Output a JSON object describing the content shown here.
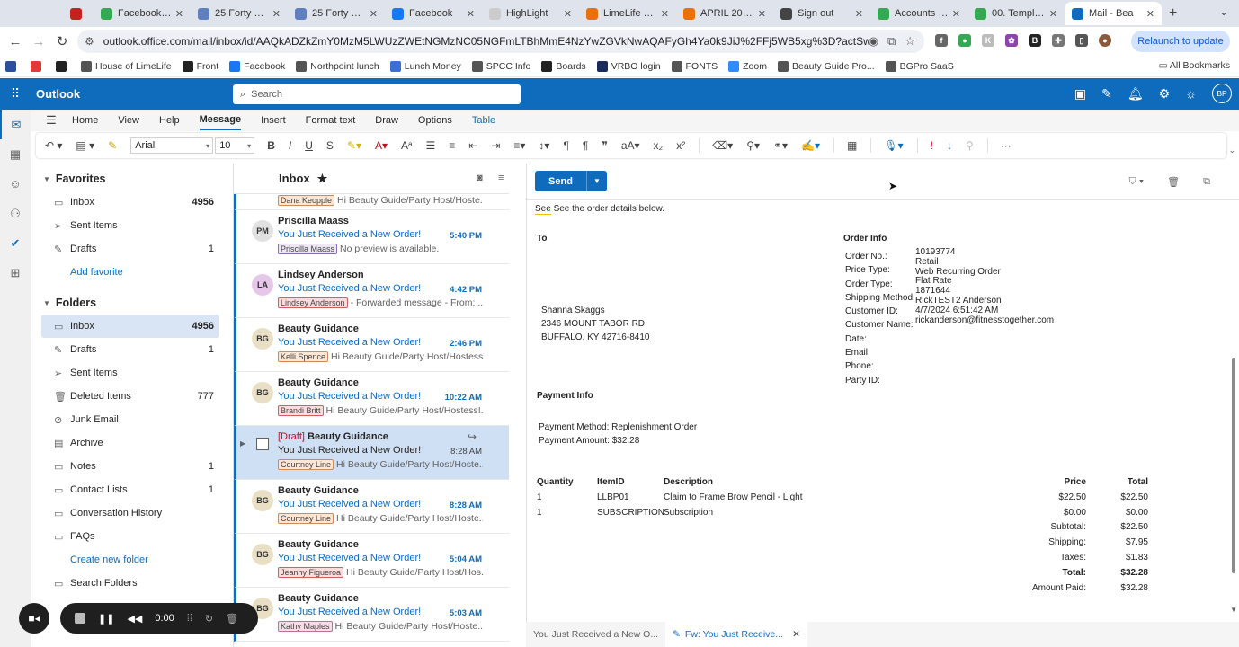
{
  "browser": {
    "tabs": [
      {
        "label": "",
        "color": "#c5221f"
      },
      {
        "label": "Facebook / In",
        "color": "#34a853"
      },
      {
        "label": "25 Forty Co.",
        "color": "#5f7fbf"
      },
      {
        "label": "25 Forty Co.",
        "color": "#5f7fbf"
      },
      {
        "label": "Facebook",
        "color": "#1877f2"
      },
      {
        "label": "HighLight",
        "color": "#cccccc"
      },
      {
        "label": "LimeLife Reso",
        "color": "#e8710a"
      },
      {
        "label": "APRIL 2024 M",
        "color": "#e8710a"
      },
      {
        "label": "Sign out",
        "color": "#444444"
      },
      {
        "label": "Accounts - A",
        "color": "#34a853"
      },
      {
        "label": "00. Template",
        "color": "#34a853"
      },
      {
        "label": "Mail - Bea",
        "color": "#0f6cbd"
      }
    ],
    "url": "outlook.office.com/mail/inbox/id/AAQkADZkZmY0MzM5LWUzZWEtNGMzNC05NGFmLTBhMmE4NzYwZGVkNwAQAFyGh4Ya0k9JiJ%2FFj5WB5xg%3D?actSwt=true",
    "relaunch_label": "Relaunch to update",
    "bookmarks": [
      {
        "label": "",
        "color": "#2b4f9e"
      },
      {
        "label": "",
        "color": "#e03a3a"
      },
      {
        "label": "",
        "color": "#222222"
      },
      {
        "label": "House of LimeLife",
        "color": "#555555"
      },
      {
        "label": "Front",
        "color": "#222222"
      },
      {
        "label": "Facebook",
        "color": "#1877f2"
      },
      {
        "label": "Northpoint lunch",
        "color": "#555555"
      },
      {
        "label": "Lunch Money",
        "color": "#3b6fd6"
      },
      {
        "label": "SPCC Info",
        "color": "#555555"
      },
      {
        "label": "Boards",
        "color": "#222222"
      },
      {
        "label": "VRBO login",
        "color": "#1a2a5a"
      },
      {
        "label": "FONTS",
        "color": "#555555"
      },
      {
        "label": "Zoom",
        "color": "#2d8cff"
      },
      {
        "label": "Beauty Guide Pro...",
        "color": "#555555"
      },
      {
        "label": "BGPro SaaS",
        "color": "#555555"
      }
    ],
    "all_bookmarks": "All Bookmarks"
  },
  "outlook": {
    "app_name": "Outlook",
    "search_placeholder": "Search",
    "avatar_initials": "BP",
    "ribbon_tabs": [
      "Home",
      "View",
      "Help",
      "Message",
      "Insert",
      "Format text",
      "Draw",
      "Options",
      "Table"
    ],
    "font_name": "Arial",
    "font_size": "10"
  },
  "folders": {
    "favorites_title": "Favorites",
    "favorites": [
      {
        "label": "Inbox",
        "count": "4956",
        "icon": "inbox-icon"
      },
      {
        "label": "Sent Items",
        "count": "",
        "icon": "send-icon"
      },
      {
        "label": "Drafts",
        "count": "1",
        "icon": "pencil-icon"
      }
    ],
    "add_favorite": "Add favorite",
    "folders_title": "Folders",
    "items": [
      {
        "label": "Inbox",
        "count": "4956"
      },
      {
        "label": "Drafts",
        "count": "1"
      },
      {
        "label": "Sent Items",
        "count": ""
      },
      {
        "label": "Deleted Items",
        "count": "777"
      },
      {
        "label": "Junk Email",
        "count": ""
      },
      {
        "label": "Archive",
        "count": ""
      },
      {
        "label": "Notes",
        "count": "1"
      },
      {
        "label": "Contact Lists",
        "count": "1"
      },
      {
        "label": "Conversation History",
        "count": ""
      },
      {
        "label": "FAQs",
        "count": ""
      }
    ],
    "create_new_folder": "Create new folder",
    "search_folders": "Search Folders"
  },
  "message_list": {
    "title": "Inbox",
    "partial": {
      "tag": "Dana Keopple",
      "preview": "Hi Beauty Guide/Party Host/Hoste..."
    },
    "messages": [
      {
        "initials": "PM",
        "avatar_color": "#e1e1e1",
        "sender": "Priscilla Maass",
        "subject": "You Just Received a New Order!",
        "time": "5:40 PM",
        "tag": "Priscilla Maass",
        "tag_style": "purple",
        "preview": "No preview is available."
      },
      {
        "initials": "LA",
        "avatar_color": "#e6c7e9",
        "sender": "Lindsey Anderson",
        "subject": "You Just Received a New Order!",
        "time": "4:42 PM",
        "tag": "Lindsey Anderson",
        "tag_style": "red",
        "preview": "- Forwarded message - From: ..."
      },
      {
        "initials": "BG",
        "avatar_color": "#e8dfc4",
        "sender": "Beauty Guidance",
        "subject": "You Just Received a New Order!",
        "time": "2:46 PM",
        "tag": "Kelli Spence",
        "tag_style": "orange",
        "preview": "Hi Beauty Guide/Party Host/Hostess..."
      },
      {
        "initials": "BG",
        "avatar_color": "#e8dfc4",
        "sender": "Beauty Guidance",
        "subject": "You Just Received a New Order!",
        "time": "10:22 AM",
        "tag": "Brandi Britt",
        "tag_style": "red",
        "preview": "Hi Beauty Guide/Party Host/Hostess!..."
      }
    ],
    "draft": {
      "draft_label": "[Draft]",
      "sender": "Beauty Guidance",
      "subject": "You Just Received a New Order!",
      "time": "8:28 AM",
      "tag": "Courtney Line",
      "tag_style": "orange",
      "preview": "Hi Beauty Guide/Party Host/Hoste..."
    },
    "messages_after": [
      {
        "initials": "BG",
        "avatar_color": "#e8dfc4",
        "sender": "Beauty Guidance",
        "subject": "You Just Received a New Order!",
        "time": "8:28 AM",
        "tag": "Courtney Line",
        "tag_style": "orange",
        "preview": "Hi Beauty Guide/Party Host/Hoste..."
      },
      {
        "initials": "BG",
        "avatar_color": "#e8dfc4",
        "sender": "Beauty Guidance",
        "subject": "You Just Received a New Order!",
        "time": "5:04 AM",
        "tag": "Jeanny Figueroa",
        "tag_style": "red",
        "preview": "Hi Beauty Guide/Party Host/Hos..."
      },
      {
        "initials": "BG",
        "avatar_color": "#e8dfc4",
        "sender": "Beauty Guidance",
        "subject": "You Just Received a New Order!",
        "time": "5:03 AM",
        "tag": "Kathy Maples",
        "tag_style": "pink",
        "preview": "Hi Beauty Guide/Party Host/Hoste..."
      }
    ]
  },
  "compose": {
    "send_label": "Send",
    "intro": "See the order details below.",
    "to_label": "To",
    "order_info_label": "Order Info",
    "recipient": {
      "name": "Shanna Skaggs",
      "street": "2346 MOUNT TABOR RD",
      "city": "BUFFALO, KY 42716-8410"
    },
    "order_labels": [
      "Order No.:",
      "Price Type:",
      "Order Type:",
      "Shipping Method:",
      "Customer ID:",
      "Customer Name:",
      "Date:",
      "Email:",
      "Phone:",
      "Party ID:"
    ],
    "order_values": [
      "10193774",
      "Retail",
      "Web Recurring Order",
      "Flat Rate",
      "1871644",
      "RickTEST2 Anderson",
      "4/7/2024 6:51:42 AM",
      "rickanderson@fitnesstogether.com"
    ],
    "payment_info_label": "Payment Info",
    "payment_method": "Payment Method: Replenishment Order",
    "payment_amount": "Payment Amount: $32.28",
    "table_headers": {
      "qty": "Quantity",
      "item": "ItemID",
      "desc": "Description",
      "price": "Price",
      "total": "Total"
    },
    "line_items": [
      {
        "qty": "1",
        "item": "LLBP01",
        "desc": "Claim to Frame Brow Pencil - Light",
        "price": "$22.50",
        "total": "$22.50"
      },
      {
        "qty": "1",
        "item": "SUBSCRIPTION",
        "desc": "Subscription",
        "price": "$0.00",
        "total": "$0.00"
      }
    ],
    "summary": [
      {
        "label": "Subtotal:",
        "value": "$22.50",
        "bold": false
      },
      {
        "label": "Shipping:",
        "value": "$7.95",
        "bold": false
      },
      {
        "label": "Taxes:",
        "value": "$1.83",
        "bold": false
      },
      {
        "label": "Total:",
        "value": "$32.28",
        "bold": true
      },
      {
        "label": "Amount Paid:",
        "value": "$32.28",
        "bold": false
      }
    ]
  },
  "draft_tabs": [
    {
      "label": "You Just Received a New O...",
      "active": false
    },
    {
      "label": "Fw: You Just Receive...",
      "active": true
    }
  ],
  "recording": {
    "time": "0:00"
  }
}
